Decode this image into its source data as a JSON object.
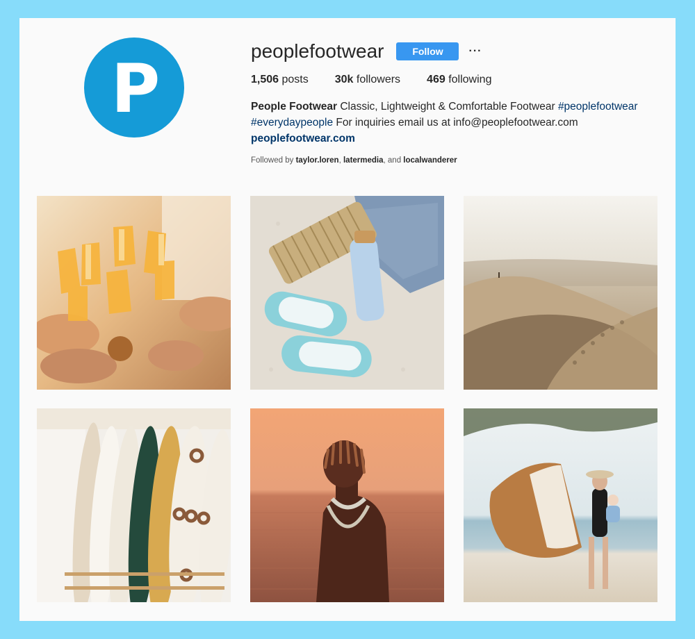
{
  "profile": {
    "avatar_letter": "P",
    "username": "peoplefootwear",
    "follow_label": "Follow",
    "more_label": "···",
    "stats": {
      "posts_value": "1,506",
      "posts_label": "posts",
      "followers_value": "30k",
      "followers_label": "followers",
      "following_value": "469",
      "following_label": "following"
    },
    "bio": {
      "name": "People Footwear",
      "text1": "Classic, Lightweight & Comfortable Footwear",
      "hashtag1": "#peoplefootwear",
      "hashtag2": "#everydaypeople",
      "text2": "For inquiries email us at info@peoplefootwear.com",
      "website": "peoplefootwear.com"
    },
    "followed_by": {
      "prefix": "Followed by",
      "user1": "taylor.loren",
      "sep1": ",",
      "user2": "latermedia",
      "sep2": ", and",
      "user3": "localwanderer"
    }
  },
  "colors": {
    "page_background": "#87dcfa",
    "avatar": "#159bd7",
    "follow_button": "#3897f0",
    "link": "#003569"
  },
  "posts": [
    {
      "subject": "champagne-toast"
    },
    {
      "subject": "beach-slides"
    },
    {
      "subject": "desert-dunes"
    },
    {
      "subject": "surfboards"
    },
    {
      "subject": "man-in-ocean"
    },
    {
      "subject": "beach-blanket"
    }
  ]
}
